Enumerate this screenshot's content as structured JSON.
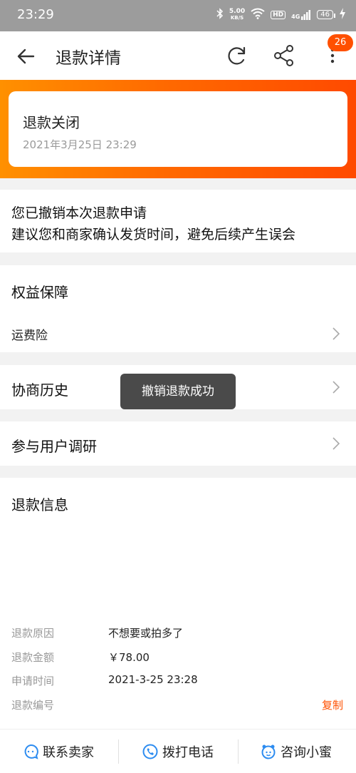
{
  "status_bar": {
    "time": "23:29",
    "net_speed_value": "5.00",
    "net_speed_unit": "KB/S",
    "hd_label": "HD",
    "signal_label": "4G",
    "battery": "46"
  },
  "nav": {
    "title": "退款详情",
    "badge_count": "26"
  },
  "refund_status": {
    "title": "退款关闭",
    "datetime": "2021年3月25日 23:29"
  },
  "notice": {
    "line1": "您已撤销本次退款申请",
    "line2": "建议您和商家确认发货时间，避免后续产生误会"
  },
  "benefits": {
    "title": "权益保障",
    "item": "运费险"
  },
  "history": {
    "title": "协商历史"
  },
  "survey": {
    "title": "参与用户调研"
  },
  "toast": {
    "message": "撤销退款成功"
  },
  "refund_info": {
    "title": "退款信息",
    "rows": [
      {
        "key": "退款原因",
        "value": "不想要或拍多了"
      },
      {
        "key": "退款金额",
        "value": "￥78.00"
      },
      {
        "key": "申请时间",
        "value": "2021-3-25 23:28"
      },
      {
        "key": "退款编号",
        "value": ""
      }
    ],
    "copy_label": "复制"
  },
  "bottom_actions": [
    {
      "label": "联系卖家",
      "icon": "chat-icon"
    },
    {
      "label": "拨打电话",
      "icon": "phone-icon"
    },
    {
      "label": "咨询小蜜",
      "icon": "assistant-icon"
    }
  ],
  "colors": {
    "accent": "#ff5000",
    "banner_start": "#ff9000",
    "banner_end": "#ff4a00",
    "icon_blue": "#2d8cf0"
  }
}
